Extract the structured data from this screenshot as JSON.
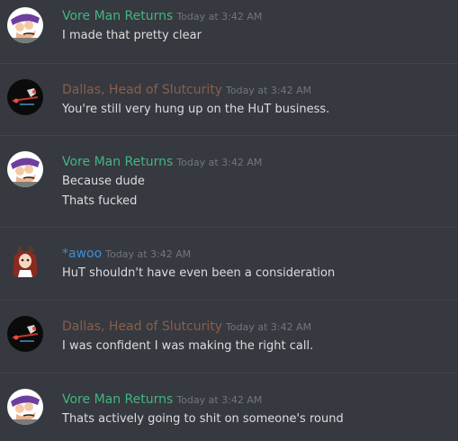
{
  "colors": {
    "background": "#36393f",
    "vore": "#43b581",
    "dallas": "#8b5e4b",
    "awoo": "#3a8fd6",
    "timestamp": "#72767d",
    "text": "#dcddde"
  },
  "messages": [
    {
      "author": "Vore Man Returns",
      "timestamp": "Today at 3:42 AM",
      "lines": [
        "I made that pretty clear"
      ]
    },
    {
      "author": "Dallas, Head of Slutcurity",
      "timestamp": "Today at 3:42 AM",
      "lines": [
        "You're still very hung up on the HuT business."
      ]
    },
    {
      "author": "Vore Man Returns",
      "timestamp": "Today at 3:42 AM",
      "lines": [
        "Because dude",
        "Thats fucked"
      ]
    },
    {
      "author": "*awoo",
      "timestamp": "Today at 3:42 AM",
      "lines": [
        "HuT shouldn't have even been a consideration"
      ]
    },
    {
      "author": "Dallas, Head of Slutcurity",
      "timestamp": "Today at 3:42 AM",
      "lines": [
        "I was confident I was making the right call."
      ]
    },
    {
      "author": "Vore Man Returns",
      "timestamp": "Today at 3:42 AM",
      "lines": [
        "Thats actively going to shit on someone's round"
      ]
    }
  ]
}
